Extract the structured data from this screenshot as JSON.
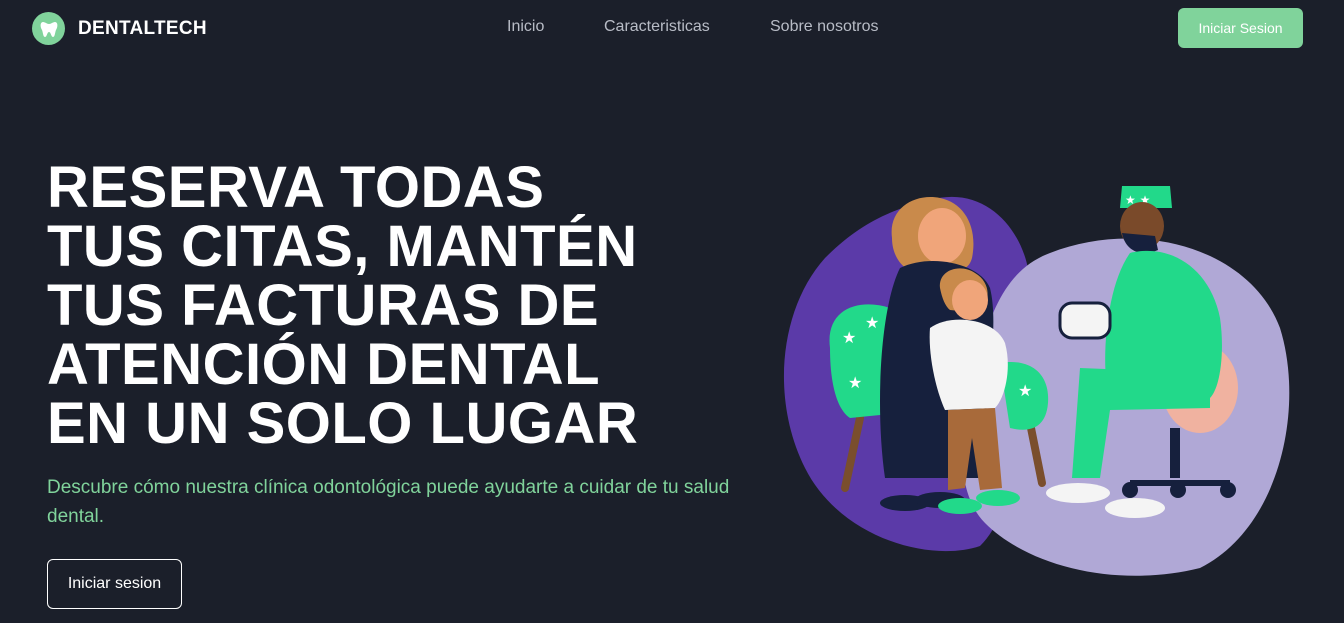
{
  "brand": {
    "name": "DENTALTECH",
    "logo_icon": "tooth-icon",
    "accent_color": "#80d39b"
  },
  "nav": {
    "links": [
      "Inicio",
      "Caracteristicas",
      "Sobre nosotros"
    ],
    "login_label": "Iniciar Sesion"
  },
  "hero": {
    "title_lines": [
      "RESERVA TODAS",
      "TUS CITAS, MANTÉN",
      "TUS FACTURAS DE",
      "ATENCIÓN DENTAL",
      "EN UN SOLO LUGAR"
    ],
    "subtitle": "Descubre cómo nuestra clínica odontológica puede ayudarte a cuidar de tu salud dental.",
    "cta_label": "Iniciar sesion",
    "illustration": "dentist-family-illustration"
  },
  "colors": {
    "background": "#1b1f2a",
    "blob_purple": "#5b3aa8",
    "blob_lavender": "#b0a8d6",
    "scrubs_green": "#22d98a"
  }
}
